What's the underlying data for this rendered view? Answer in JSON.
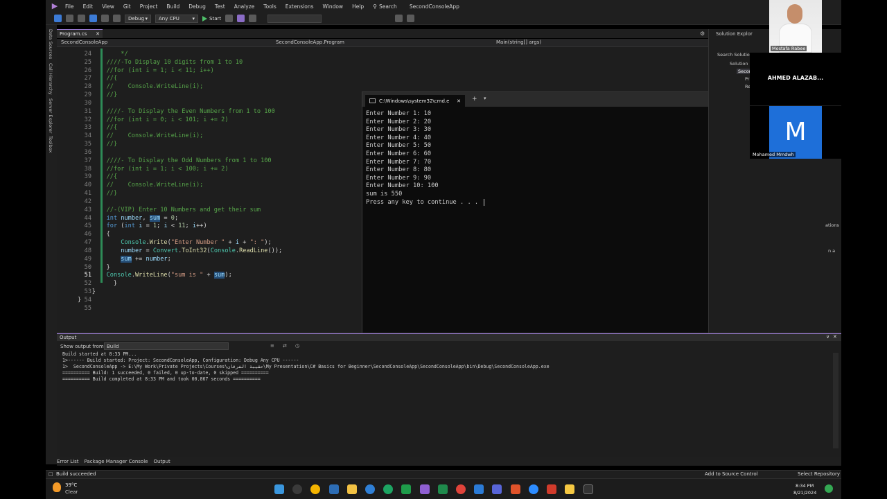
{
  "menu": {
    "items": [
      "File",
      "Edit",
      "View",
      "Git",
      "Project",
      "Build",
      "Debug",
      "Test",
      "Analyze",
      "Tools",
      "Extensions",
      "Window",
      "Help"
    ],
    "search_label": "Search",
    "solution_title": "SecondConsoleApp"
  },
  "toolbar": {
    "config": "Debug",
    "platform": "Any CPU",
    "start_label": "Start"
  },
  "left_rail": [
    "Data Sources",
    "Call Hierarchy",
    "Server Explorer",
    "Toolbox"
  ],
  "editor": {
    "file_tab": "Program.cs",
    "nav_project": "SecondConsoleApp",
    "nav_class": "SecondConsoleApp.Program",
    "nav_member": "Main(string[] args)",
    "current_line": "51",
    "lines": [
      {
        "n": "24",
        "text": "    */"
      },
      {
        "n": "25",
        "text": "////-To Display 10 digits from 1 to 10"
      },
      {
        "n": "26",
        "text": "//for (int i = 1; i < 11; i++)"
      },
      {
        "n": "27",
        "text": "//{"
      },
      {
        "n": "28",
        "text": "//    Console.WriteLine(i);"
      },
      {
        "n": "29",
        "text": "//}"
      },
      {
        "n": "30",
        "text": ""
      },
      {
        "n": "31",
        "text": "////- To Display the Even Numbers from 1 to 100"
      },
      {
        "n": "32",
        "text": "//for (int i = 0; i < 101; i += 2)"
      },
      {
        "n": "33",
        "text": "//{"
      },
      {
        "n": "34",
        "text": "//    Console.WriteLine(i);"
      },
      {
        "n": "35",
        "text": "//}"
      },
      {
        "n": "36",
        "text": ""
      },
      {
        "n": "37",
        "text": "////- To Display the Odd Numbers from 1 to 100"
      },
      {
        "n": "38",
        "text": "//for (int i = 1; i < 100; i += 2)"
      },
      {
        "n": "39",
        "text": "//{"
      },
      {
        "n": "40",
        "text": "//    Console.WriteLine(i);"
      },
      {
        "n": "41",
        "text": "//}"
      },
      {
        "n": "42",
        "text": ""
      },
      {
        "n": "43",
        "text": "//-(VIP) Enter 10 Numbers and get their sum"
      },
      {
        "n": "44",
        "text": "int number, sum = 0;"
      },
      {
        "n": "45",
        "text": "for (int i = 1; i < 11; i++)"
      },
      {
        "n": "46",
        "text": "{"
      },
      {
        "n": "47",
        "text": "    Console.Write(\"Enter Number \" + i + \": \");"
      },
      {
        "n": "48",
        "text": "    number = Convert.ToInt32(Console.ReadLine());"
      },
      {
        "n": "49",
        "text": "    sum += number;"
      },
      {
        "n": "50",
        "text": "}"
      },
      {
        "n": "51",
        "text": "Console.WriteLine(\"sum is \" + sum);"
      },
      {
        "n": "52",
        "text": "    }"
      },
      {
        "n": "53",
        "text": "}"
      },
      {
        "n": "54",
        "text": "}"
      },
      {
        "n": "55",
        "text": ""
      }
    ]
  },
  "console": {
    "tab_title": "C:\\Windows\\system32\\cmd.e",
    "lines": [
      "Enter Number 1: 10",
      "Enter Number 2: 20",
      "Enter Number 3: 30",
      "Enter Number 4: 40",
      "Enter Number 5: 50",
      "Enter Number 6: 60",
      "Enter Number 7: 70",
      "Enter Number 8: 80",
      "Enter Number 9: 90",
      "Enter Number 10: 100",
      "sum is 550",
      "Press any key to continue . . . "
    ]
  },
  "solution_explorer": {
    "title": "Solution Explor",
    "search": "Search Solution",
    "items": [
      "Solution '",
      "Secon",
      "Pr",
      "Re"
    ],
    "side_text": [
      "ations",
      "n a"
    ]
  },
  "participants": [
    {
      "name": "Mostafa Rabee"
    },
    {
      "name": "AHMED  ALAZAB..."
    },
    {
      "name": "Mohamed Mmdwh",
      "initial": "M"
    }
  ],
  "output": {
    "title": "Output",
    "show_from_label": "Show output from:",
    "show_from_value": "Build",
    "lines": [
      "Build started at 8:33 PM...",
      "1>------ Build started: Project: SecondConsoleApp, Configuration: Debug Any CPU ------",
      "1>  SecondConsoleApp -> E:\\My Work\\Private Projects\\Courses\\حقيبة الفرقان\\My Presentation\\C# Basics for Beginner\\SecondConsoleApp\\SecondConsoleApp\\bin\\Debug\\SecondConsoleApp.exe",
      "========== Build: 1 succeeded, 0 failed, 0 up-to-date, 0 skipped ==========",
      "========== Build completed at 8:33 PM and took 00.867 seconds =========="
    ]
  },
  "bottom_tabs": [
    "Error List",
    "Package Manager Console",
    "Output"
  ],
  "status": {
    "left": "Build succeeded",
    "source_control": "Add to Source Control",
    "repo": "Select Repository"
  },
  "taskbar": {
    "temp": "39°C",
    "weather": "Clear",
    "time": "8:34 PM",
    "date": "8/21/2024"
  },
  "colors": {
    "comment": "#57a64a",
    "keyword": "#569cd6",
    "string": "#d69d85",
    "accent": "#9b7bd5",
    "build_green": "#2e8b57"
  }
}
